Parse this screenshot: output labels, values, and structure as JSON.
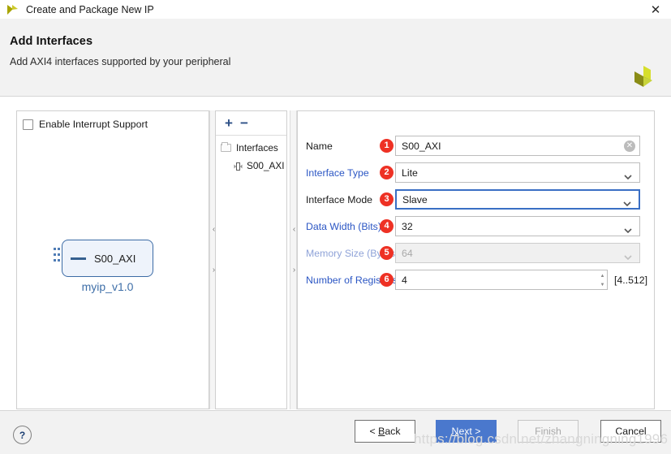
{
  "window": {
    "title": "Create and Package New IP",
    "app_icon": "vivado-logo-icon",
    "close_label": "✕"
  },
  "header": {
    "title": "Add Interfaces",
    "subtitle": "Add AXI4 interfaces supported by your peripheral",
    "logo": "xilinx-logo-icon"
  },
  "diagram_panel": {
    "checkbox": {
      "label": "Enable Interrupt Support",
      "checked": false
    },
    "block": {
      "interface_name": "S00_AXI",
      "caption": "myip_v1.0"
    }
  },
  "tree_panel": {
    "add_label": "+",
    "remove_label": "−",
    "root": {
      "label": "Interfaces",
      "icon": "folder-icon"
    },
    "child": {
      "label": "S00_AXI",
      "icon": "interface-icon"
    }
  },
  "form": {
    "rows": [
      {
        "badge": "1",
        "label": "Name",
        "value": "S00_AXI",
        "control": "text",
        "state": "normal",
        "accessory": "clear-icon"
      },
      {
        "badge": "2",
        "label": "Interface Type",
        "value": "Lite",
        "control": "dropdown",
        "state": "link",
        "accessory": "chevron-down-icon"
      },
      {
        "badge": "3",
        "label": "Interface Mode",
        "value": "Slave",
        "control": "dropdown",
        "state": "focused",
        "accessory": "chevron-down-icon"
      },
      {
        "badge": "4",
        "label": "Data Width (Bits)",
        "value": "32",
        "control": "dropdown",
        "state": "link",
        "accessory": "chevron-down-icon"
      },
      {
        "badge": "5",
        "label": "Memory Size (Bytes)",
        "value": "64",
        "control": "dropdown",
        "state": "disabled",
        "accessory": "chevron-down-icon"
      },
      {
        "badge": "6",
        "label": "Number of Registers",
        "value": "4",
        "control": "spinner",
        "state": "link",
        "accessory": "spinner-icon",
        "range": "[4..512]"
      }
    ]
  },
  "splitters": {
    "collapse_left": "‹",
    "collapse_right": "›"
  },
  "footer": {
    "help_label": "?",
    "back_label": "< Back",
    "back_mnemonic": "B",
    "next_label": "Next >",
    "next_mnemonic": "N",
    "finish_label": "Finish",
    "cancel_label": "Cancel"
  },
  "watermark": {
    "text": "https://blog.csdn.net/zhangningning1996"
  },
  "colors": {
    "accent_blue": "#4a78cd",
    "badge_red": "#ee3124",
    "link_blue": "#2b56c4",
    "header_bg": "#f2f2f2",
    "block_border": "#3c6ba5"
  }
}
